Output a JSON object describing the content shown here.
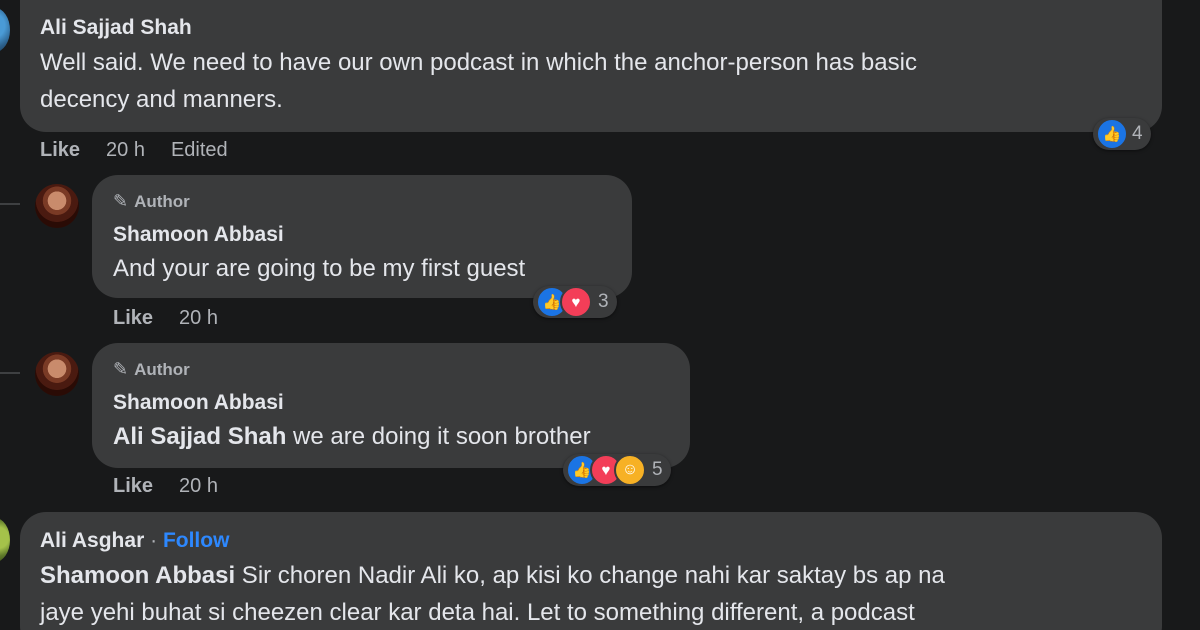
{
  "comments": [
    {
      "author": "Ali Sajjad Shah",
      "text_lines": [
        "Well said. We need to have our own podcast in which the anchor-person has basic",
        "decency and manners."
      ],
      "actions": {
        "like": "Like",
        "time": "20 h",
        "edited": "Edited"
      },
      "reactions": {
        "icons": [
          "like-icon"
        ],
        "count": "4"
      }
    },
    {
      "badge": "Author",
      "author": "Shamoon Abbasi",
      "text": "And your are going to be my first guest",
      "actions": {
        "like": "Like",
        "time": "20 h"
      },
      "reactions": {
        "icons": [
          "like-icon",
          "love-icon"
        ],
        "count": "3"
      }
    },
    {
      "badge": "Author",
      "author": "Shamoon Abbasi",
      "mention": "Ali Sajjad Shah",
      "text": " we are doing it soon brother",
      "actions": {
        "like": "Like",
        "time": "20 h"
      },
      "reactions": {
        "icons": [
          "like-icon",
          "love-icon",
          "care-icon"
        ],
        "count": "5"
      }
    },
    {
      "author": "Ali Asghar",
      "separator": "·",
      "follow": "Follow",
      "mention": "Shamoon Abbasi",
      "text_line1": " Sir choren Nadir Ali ko, ap kisi ko change nahi kar saktay bs ap na",
      "text_line2": "jaye yehi buhat si cheezen clear kar deta hai. Let to something different, a podcast"
    }
  ],
  "colors": {
    "background": "#18191a",
    "bubble": "#3a3b3c",
    "text": "#e4e6eb",
    "secondary_text": "#b0b3b8",
    "link": "#2d88ff",
    "like": "#1b74e4",
    "love": "#f33e58"
  }
}
